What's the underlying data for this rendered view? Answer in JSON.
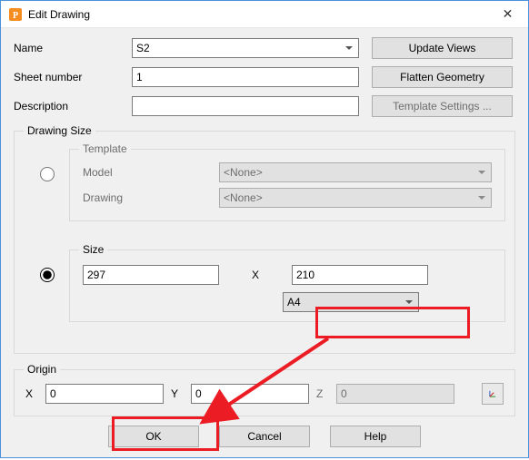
{
  "window": {
    "title": "Edit Drawing",
    "close_tooltip": "Close"
  },
  "fields": {
    "name_label": "Name",
    "name_value": "S2",
    "sheet_label": "Sheet number",
    "sheet_value": "1",
    "desc_label": "Description",
    "desc_value": ""
  },
  "buttons": {
    "update_views": "Update Views",
    "flatten": "Flatten Geometry",
    "template_settings": "Template Settings ...",
    "ok": "OK",
    "cancel": "Cancel",
    "help": "Help"
  },
  "drawing_size": {
    "legend": "Drawing Size",
    "template_legend": "Template",
    "template_model_label": "Model",
    "template_model_value": "<None>",
    "template_drawing_label": "Drawing",
    "template_drawing_value": "<None>",
    "size_legend": "Size",
    "width": "297",
    "x_sep": "X",
    "height": "210",
    "paper": "A4",
    "selected": "size"
  },
  "origin": {
    "legend": "Origin",
    "x_label": "X",
    "x_value": "0",
    "y_label": "Y",
    "y_value": "0",
    "z_label": "Z",
    "z_value": "0"
  },
  "icons": {
    "app": "P",
    "close": "✕",
    "pick": "xyz"
  }
}
